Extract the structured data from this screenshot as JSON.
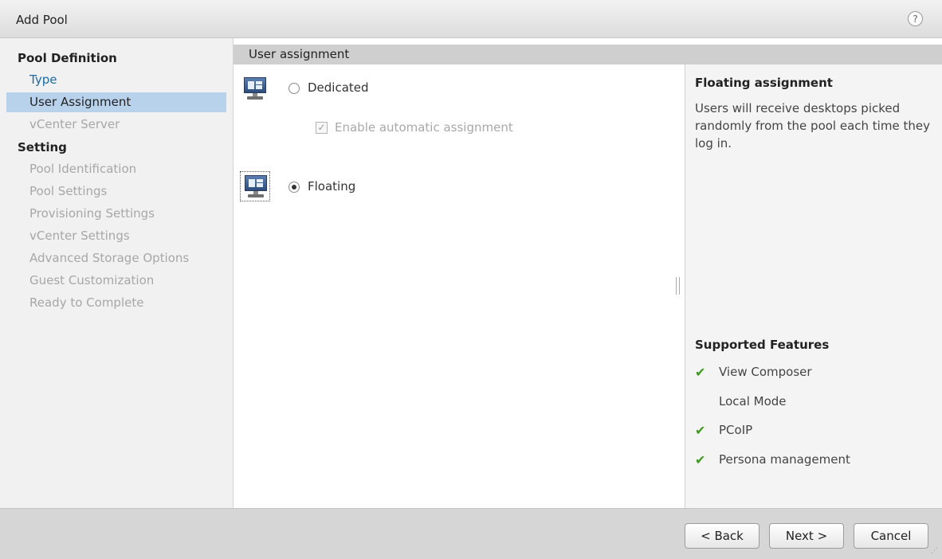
{
  "dialog": {
    "title": "Add Pool",
    "help_label": "?"
  },
  "sidebar": {
    "heading1": "Pool Definition",
    "items1": [
      {
        "label": "Type",
        "state": "link"
      },
      {
        "label": "User Assignment",
        "state": "selected"
      },
      {
        "label": "vCenter Server",
        "state": "disabled"
      }
    ],
    "heading2": "Setting",
    "items2": [
      {
        "label": "Pool Identification",
        "state": "disabled"
      },
      {
        "label": "Pool Settings",
        "state": "disabled"
      },
      {
        "label": "Provisioning Settings",
        "state": "disabled"
      },
      {
        "label": "vCenter Settings",
        "state": "disabled"
      },
      {
        "label": "Advanced Storage Options",
        "state": "disabled"
      },
      {
        "label": "Guest Customization",
        "state": "disabled"
      },
      {
        "label": "Ready to Complete",
        "state": "disabled"
      }
    ]
  },
  "content": {
    "header": "User assignment",
    "options": {
      "dedicated": {
        "label": "Dedicated",
        "selected": false
      },
      "auto_assign": {
        "label": "Enable automatic assignment",
        "checked": true,
        "enabled": false
      },
      "floating": {
        "label": "Floating",
        "selected": true
      }
    }
  },
  "help": {
    "title": "Floating assignment",
    "description": "Users will receive desktops picked randomly from the pool each time they log in.",
    "features_title": "Supported Features",
    "features": [
      {
        "label": "View Composer",
        "supported": true
      },
      {
        "label": "Local Mode",
        "supported": false
      },
      {
        "label": "PCoIP",
        "supported": true
      },
      {
        "label": "Persona management",
        "supported": true
      }
    ],
    "check_color": "#3d9a1f"
  },
  "footer": {
    "back": "< Back",
    "next": "Next >",
    "cancel": "Cancel"
  }
}
